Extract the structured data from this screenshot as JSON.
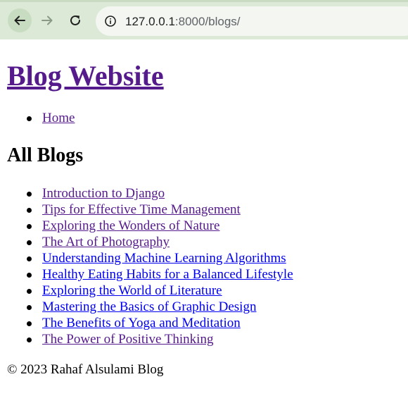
{
  "browser": {
    "url_host": "127.0.0.1",
    "url_rest": ":8000/blogs/",
    "back_icon": "arrow-left-icon",
    "forward_icon": "arrow-right-icon",
    "reload_icon": "reload-icon",
    "info_icon": "info-circle-icon"
  },
  "site": {
    "title": "Blog Website"
  },
  "nav": {
    "items": [
      {
        "label": "Home"
      }
    ]
  },
  "main": {
    "heading": "All Blogs",
    "blogs": [
      {
        "title": "Introduction to Django"
      },
      {
        "title": "Tips for Effective Time Management"
      },
      {
        "title": "Exploring the Wonders of Nature"
      },
      {
        "title": "The Art of Photography"
      },
      {
        "title": "Understanding Machine Learning Algorithms"
      },
      {
        "title": "Healthy Eating Habits for a Balanced Lifestyle"
      },
      {
        "title": "Exploring the World of Literature"
      },
      {
        "title": "Mastering the Basics of Graphic Design"
      },
      {
        "title": "The Benefits of Yoga and Meditation"
      },
      {
        "title": "The Power of Positive Thinking"
      }
    ]
  },
  "footer": {
    "text": "© 2023 Rahaf Alsulami Blog"
  },
  "colors": {
    "visited_link": "#551a8b",
    "unvisited_link": "#0000ee",
    "toolbar": "#dbe9d6"
  }
}
